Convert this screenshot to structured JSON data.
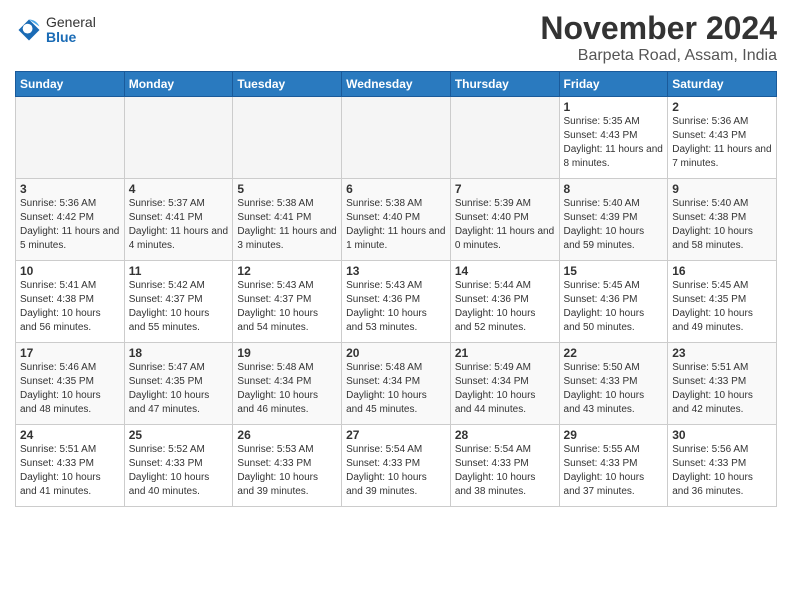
{
  "header": {
    "logo_general": "General",
    "logo_blue": "Blue",
    "month_title": "November 2024",
    "location": "Barpeta Road, Assam, India"
  },
  "weekdays": [
    "Sunday",
    "Monday",
    "Tuesday",
    "Wednesday",
    "Thursday",
    "Friday",
    "Saturday"
  ],
  "weeks": [
    [
      {
        "day": "",
        "empty": true
      },
      {
        "day": "",
        "empty": true
      },
      {
        "day": "",
        "empty": true
      },
      {
        "day": "",
        "empty": true
      },
      {
        "day": "",
        "empty": true
      },
      {
        "day": "1",
        "sunrise": "5:35 AM",
        "sunset": "4:43 PM",
        "daylight": "11 hours and 8 minutes."
      },
      {
        "day": "2",
        "sunrise": "5:36 AM",
        "sunset": "4:43 PM",
        "daylight": "11 hours and 7 minutes."
      }
    ],
    [
      {
        "day": "3",
        "sunrise": "5:36 AM",
        "sunset": "4:42 PM",
        "daylight": "11 hours and 5 minutes."
      },
      {
        "day": "4",
        "sunrise": "5:37 AM",
        "sunset": "4:41 PM",
        "daylight": "11 hours and 4 minutes."
      },
      {
        "day": "5",
        "sunrise": "5:38 AM",
        "sunset": "4:41 PM",
        "daylight": "11 hours and 3 minutes."
      },
      {
        "day": "6",
        "sunrise": "5:38 AM",
        "sunset": "4:40 PM",
        "daylight": "11 hours and 1 minute."
      },
      {
        "day": "7",
        "sunrise": "5:39 AM",
        "sunset": "4:40 PM",
        "daylight": "11 hours and 0 minutes."
      },
      {
        "day": "8",
        "sunrise": "5:40 AM",
        "sunset": "4:39 PM",
        "daylight": "10 hours and 59 minutes."
      },
      {
        "day": "9",
        "sunrise": "5:40 AM",
        "sunset": "4:38 PM",
        "daylight": "10 hours and 58 minutes."
      }
    ],
    [
      {
        "day": "10",
        "sunrise": "5:41 AM",
        "sunset": "4:38 PM",
        "daylight": "10 hours and 56 minutes."
      },
      {
        "day": "11",
        "sunrise": "5:42 AM",
        "sunset": "4:37 PM",
        "daylight": "10 hours and 55 minutes."
      },
      {
        "day": "12",
        "sunrise": "5:43 AM",
        "sunset": "4:37 PM",
        "daylight": "10 hours and 54 minutes."
      },
      {
        "day": "13",
        "sunrise": "5:43 AM",
        "sunset": "4:36 PM",
        "daylight": "10 hours and 53 minutes."
      },
      {
        "day": "14",
        "sunrise": "5:44 AM",
        "sunset": "4:36 PM",
        "daylight": "10 hours and 52 minutes."
      },
      {
        "day": "15",
        "sunrise": "5:45 AM",
        "sunset": "4:36 PM",
        "daylight": "10 hours and 50 minutes."
      },
      {
        "day": "16",
        "sunrise": "5:45 AM",
        "sunset": "4:35 PM",
        "daylight": "10 hours and 49 minutes."
      }
    ],
    [
      {
        "day": "17",
        "sunrise": "5:46 AM",
        "sunset": "4:35 PM",
        "daylight": "10 hours and 48 minutes."
      },
      {
        "day": "18",
        "sunrise": "5:47 AM",
        "sunset": "4:35 PM",
        "daylight": "10 hours and 47 minutes."
      },
      {
        "day": "19",
        "sunrise": "5:48 AM",
        "sunset": "4:34 PM",
        "daylight": "10 hours and 46 minutes."
      },
      {
        "day": "20",
        "sunrise": "5:48 AM",
        "sunset": "4:34 PM",
        "daylight": "10 hours and 45 minutes."
      },
      {
        "day": "21",
        "sunrise": "5:49 AM",
        "sunset": "4:34 PM",
        "daylight": "10 hours and 44 minutes."
      },
      {
        "day": "22",
        "sunrise": "5:50 AM",
        "sunset": "4:33 PM",
        "daylight": "10 hours and 43 minutes."
      },
      {
        "day": "23",
        "sunrise": "5:51 AM",
        "sunset": "4:33 PM",
        "daylight": "10 hours and 42 minutes."
      }
    ],
    [
      {
        "day": "24",
        "sunrise": "5:51 AM",
        "sunset": "4:33 PM",
        "daylight": "10 hours and 41 minutes."
      },
      {
        "day": "25",
        "sunrise": "5:52 AM",
        "sunset": "4:33 PM",
        "daylight": "10 hours and 40 minutes."
      },
      {
        "day": "26",
        "sunrise": "5:53 AM",
        "sunset": "4:33 PM",
        "daylight": "10 hours and 39 minutes."
      },
      {
        "day": "27",
        "sunrise": "5:54 AM",
        "sunset": "4:33 PM",
        "daylight": "10 hours and 39 minutes."
      },
      {
        "day": "28",
        "sunrise": "5:54 AM",
        "sunset": "4:33 PM",
        "daylight": "10 hours and 38 minutes."
      },
      {
        "day": "29",
        "sunrise": "5:55 AM",
        "sunset": "4:33 PM",
        "daylight": "10 hours and 37 minutes."
      },
      {
        "day": "30",
        "sunrise": "5:56 AM",
        "sunset": "4:33 PM",
        "daylight": "10 hours and 36 minutes."
      }
    ]
  ]
}
